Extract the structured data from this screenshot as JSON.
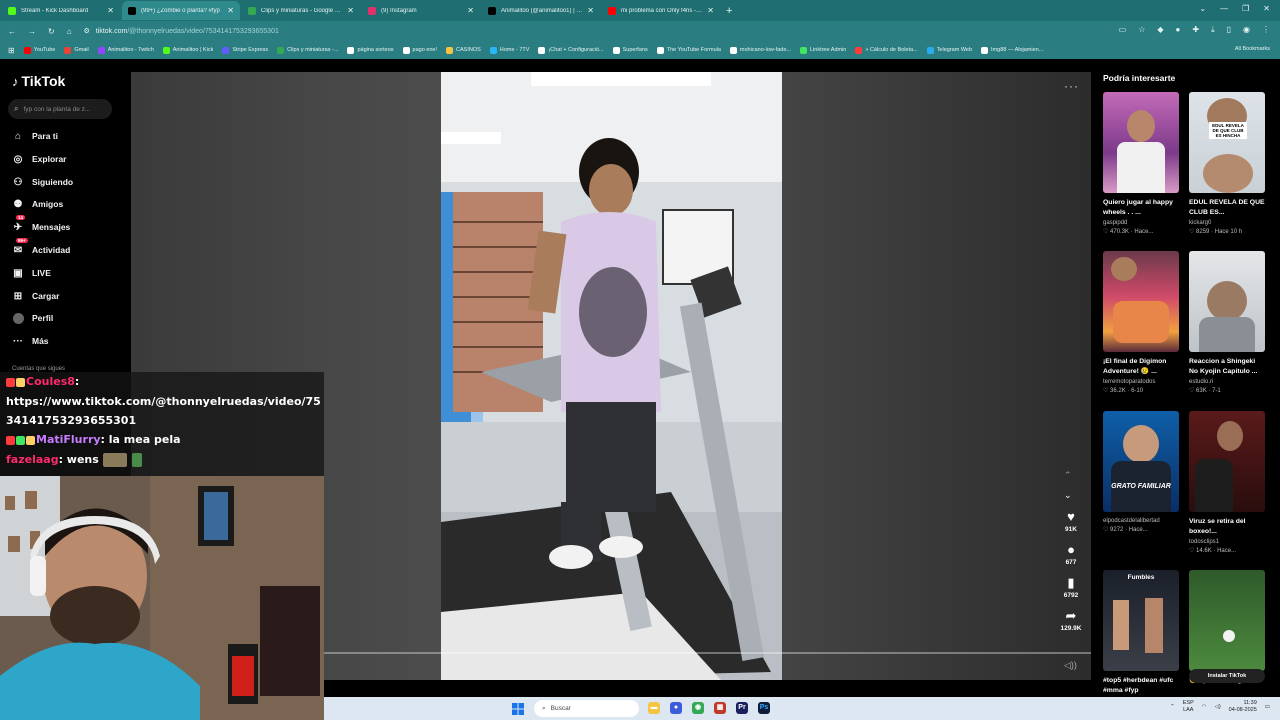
{
  "browser": {
    "tabs": [
      {
        "title": "Stream - Kick Dashboard",
        "color": "#53fc18",
        "active": false
      },
      {
        "title": "(99+) ¿Zombie o planta? #fyp",
        "color": "#000000",
        "active": true
      },
      {
        "title": "Clips y miniaturas - Google Drive",
        "color": "#34a853",
        "active": false
      },
      {
        "title": "(9) Instagram",
        "color": "#e1306c",
        "active": false
      },
      {
        "title": "Animalitoo (@animalitoo1) | TikTok",
        "color": "#000000",
        "active": false
      },
      {
        "title": "mi problema con Only f4ns - YouTube",
        "color": "#ff0000",
        "active": false
      }
    ],
    "url_host": "tiktok.com",
    "url_path": "/@thonnyelruedas/video/7534141753293655301",
    "bookmarks": [
      {
        "label": "YouTube",
        "color": "#ff0000"
      },
      {
        "label": "Gmail",
        "color": "#ea4335"
      },
      {
        "label": "Animalitoo - Twitch",
        "color": "#9146ff"
      },
      {
        "label": "Animalitoo | Kick",
        "color": "#53fc18"
      },
      {
        "label": "Stripe Express",
        "color": "#635bff"
      },
      {
        "label": "Clips y miniaturas -...",
        "color": "#34a853"
      },
      {
        "label": "página sorteos",
        "color": "#ffffff"
      },
      {
        "label": "pago ene!",
        "color": "#ffffff"
      },
      {
        "label": "CASINOS",
        "color": "#f5c542"
      },
      {
        "label": "Home - 7TV",
        "color": "#29b6f6"
      },
      {
        "label": "¡Chat + Configuració...",
        "color": "#ffffff"
      },
      {
        "label": "Superfans",
        "color": "#ffffff"
      },
      {
        "label": "The YouTube Formula",
        "color": "#ffffff"
      },
      {
        "label": "mohicano-low-fade...",
        "color": "#ffffff"
      },
      {
        "label": "Linktree Admin",
        "color": "#43e660"
      },
      {
        "label": "» Cálculo de Boleta...",
        "color": "#ff3b3b"
      },
      {
        "label": "Telegram Web",
        "color": "#2aabee"
      },
      {
        "label": "Img88 — Alojamien...",
        "color": "#ffffff"
      }
    ],
    "all_bookmarks": "All Bookmarks"
  },
  "sidebar": {
    "logo": "TikTok",
    "search_placeholder": "fyp con la planta de z...",
    "items": [
      {
        "label": "Para ti",
        "icon": "home-icon"
      },
      {
        "label": "Explorar",
        "icon": "compass-icon"
      },
      {
        "label": "Siguiendo",
        "icon": "following-icon"
      },
      {
        "label": "Amigos",
        "icon": "friends-icon"
      },
      {
        "label": "Mensajes",
        "icon": "messages-icon",
        "badge": "14"
      },
      {
        "label": "Actividad",
        "icon": "activity-icon",
        "badge": "99+"
      },
      {
        "label": "LIVE",
        "icon": "live-icon"
      },
      {
        "label": "Cargar",
        "icon": "upload-icon"
      },
      {
        "label": "Perfil",
        "icon": "profile-icon"
      },
      {
        "label": "Más",
        "icon": "more-icon"
      }
    ],
    "following_header": "Cuentas que sigues"
  },
  "video": {
    "likes": "91K",
    "comments": "677",
    "saves": "6792",
    "shares": "129.9K"
  },
  "recs": {
    "title": "Podría interesarte",
    "cards": [
      {
        "title": "Quiero jugar al happy wheels . . ...",
        "user": "gaspipdd",
        "views": "470.3K",
        "time": "Hace..."
      },
      {
        "title": "EDUL REVELA DE QUE CLUB ES...",
        "user": "kickarg0",
        "views": "8259",
        "time": "Hace 10 h"
      },
      {
        "title": "¡El final de Digimon Adventure! 😢 ...",
        "user": "terremotoparatodos",
        "views": "36.2K",
        "time": "6-10"
      },
      {
        "title": "Reaccion a Shingeki No Kyojin Capitulo ...",
        "user": "estudio.ri",
        "views": "63K",
        "time": "7-1"
      },
      {
        "title": "",
        "user": "elpodcastdelalibertad",
        "views": "9272",
        "time": "Hace..."
      },
      {
        "title": "Viruz se retira del boxeo!...",
        "user": "todosclips1",
        "views": "14.6K",
        "time": "Hace..."
      },
      {
        "title": "#top5 #herbdean #ufc #mma #fyp",
        "user": "",
        "views": "",
        "time": ""
      },
      {
        "title": "🤩 #premierleague...",
        "user": "",
        "views": "",
        "time": ""
      }
    ],
    "thumb_text": {
      "edul": "EDUL REVELA DE QUE CLUB ES HINCHA",
      "podcast": "GRATO FAMILIAR",
      "fumbles": "Fumbles",
      "install": "Instalar TikTok"
    }
  },
  "chat": {
    "user1": "Coules8",
    "msg1": "https://www.tiktok.com/@thonnyelruedas/video/7534141753293655301",
    "user2": "MatiFlurry",
    "msg2": "la mea pela",
    "user3": "fazelaag",
    "msg3": "wens"
  },
  "taskbar": {
    "search_placeholder": "Buscar",
    "lang_top": "ESP",
    "lang_bottom": "LAA",
    "time": "11:39",
    "date": "04-08-2025"
  }
}
